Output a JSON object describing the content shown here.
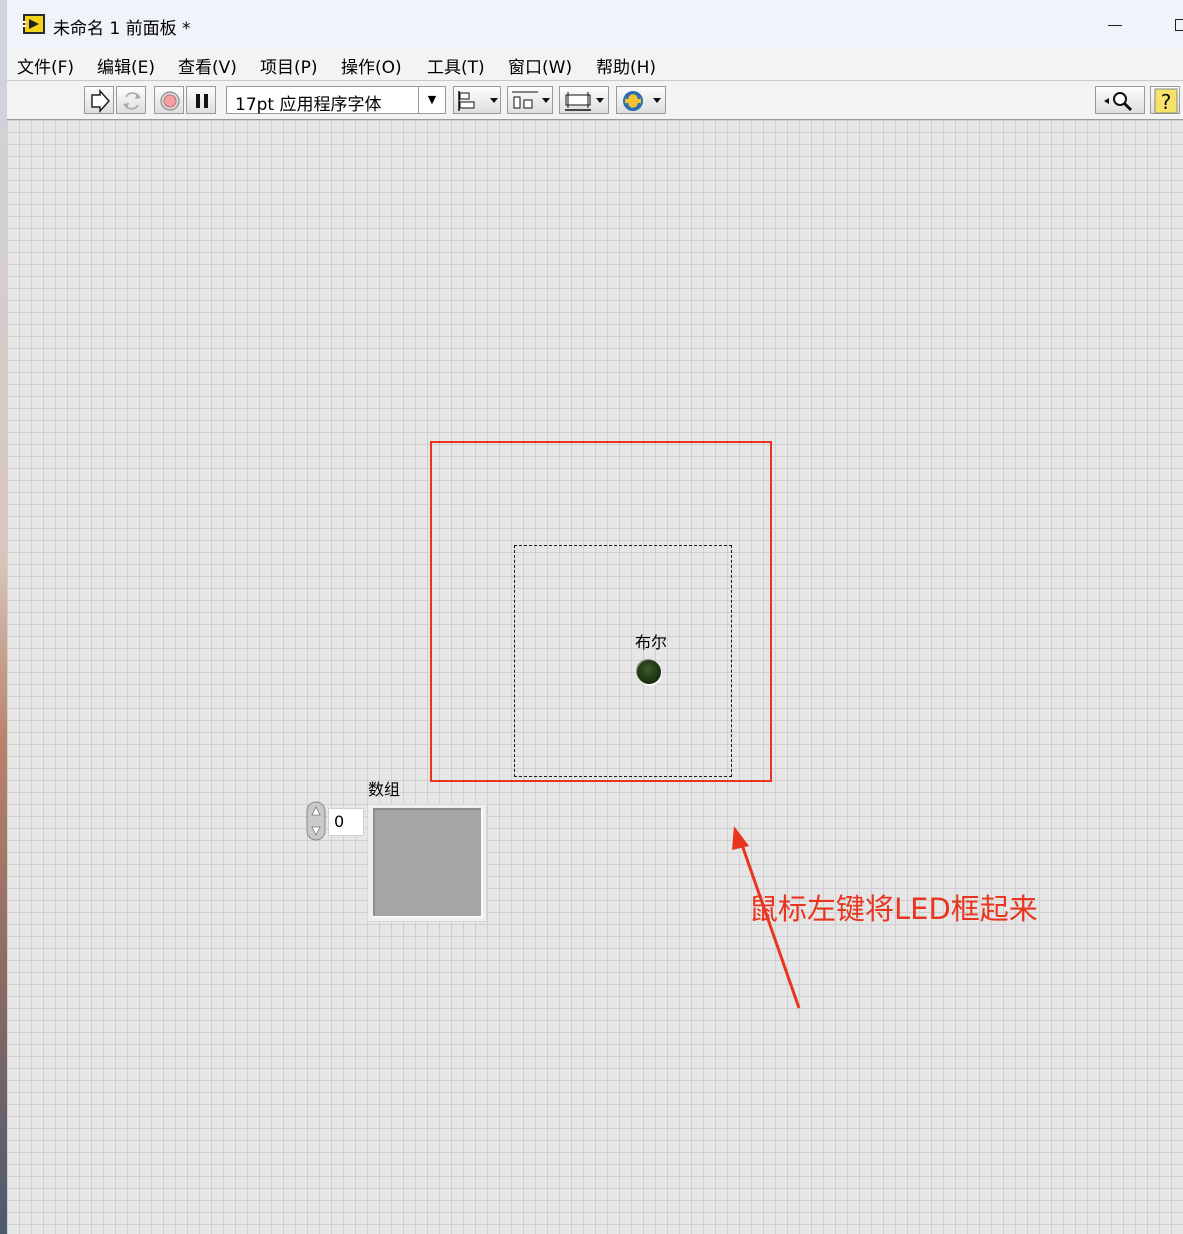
{
  "window": {
    "title": "未命名 1 前面板 *"
  },
  "menu": [
    {
      "label": "文件(F)"
    },
    {
      "label": "编辑(E)"
    },
    {
      "label": "查看(V)"
    },
    {
      "label": "项目(P)"
    },
    {
      "label": "操作(O)"
    },
    {
      "label": "工具(T)"
    },
    {
      "label": "窗口(W)"
    },
    {
      "label": "帮助(H)"
    }
  ],
  "toolbar": {
    "font_value": "17pt 应用程序字体",
    "icons": [
      "run-arrow-icon",
      "run-continuously-icon",
      "abort-icon",
      "pause-icon",
      "align-objects-icon",
      "distribute-objects-icon",
      "resize-objects-icon",
      "reorder-icon",
      "search-icon",
      "context-help-icon"
    ]
  },
  "front_panel": {
    "led_label": "布尔",
    "array_label": "数组",
    "array_index": "0"
  },
  "annotation": {
    "text": "鼠标左键将LED框起来",
    "color": "#e9351f"
  }
}
